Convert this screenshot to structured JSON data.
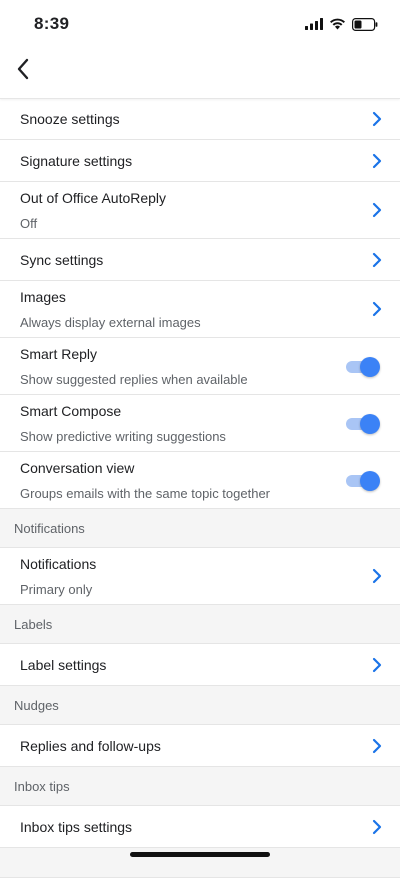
{
  "status_bar": {
    "time": "8:39"
  },
  "icons": {
    "back": "chevron-left-icon",
    "chevron": "chevron-right-icon",
    "signal": "signal-icon",
    "wifi": "wifi-icon",
    "battery": "battery-icon"
  },
  "colors": {
    "accent": "#1a73e8",
    "toggle_on": "#3b82f6",
    "section_bg": "#f5f5f5"
  },
  "rows": {
    "snooze": {
      "title": "Snooze settings"
    },
    "signature": {
      "title": "Signature settings"
    },
    "out_of_office": {
      "title": "Out of Office AutoReply",
      "subtitle": "Off"
    },
    "sync": {
      "title": "Sync settings"
    },
    "images": {
      "title": "Images",
      "subtitle": "Always display external images"
    },
    "smart_reply": {
      "title": "Smart Reply",
      "subtitle": "Show suggested replies when available",
      "enabled": true
    },
    "smart_compose": {
      "title": "Smart Compose",
      "subtitle": "Show predictive writing suggestions",
      "enabled": true
    },
    "conversation_view": {
      "title": "Conversation view",
      "subtitle": "Groups emails with the same topic together",
      "enabled": true
    }
  },
  "sections": {
    "notifications": {
      "header": "Notifications",
      "item": {
        "title": "Notifications",
        "subtitle": "Primary only"
      }
    },
    "labels": {
      "header": "Labels",
      "item": {
        "title": "Label settings"
      }
    },
    "nudges": {
      "header": "Nudges",
      "item": {
        "title": "Replies and follow-ups"
      }
    },
    "inbox_tips": {
      "header": "Inbox tips",
      "item": {
        "title": "Inbox tips settings"
      }
    }
  }
}
